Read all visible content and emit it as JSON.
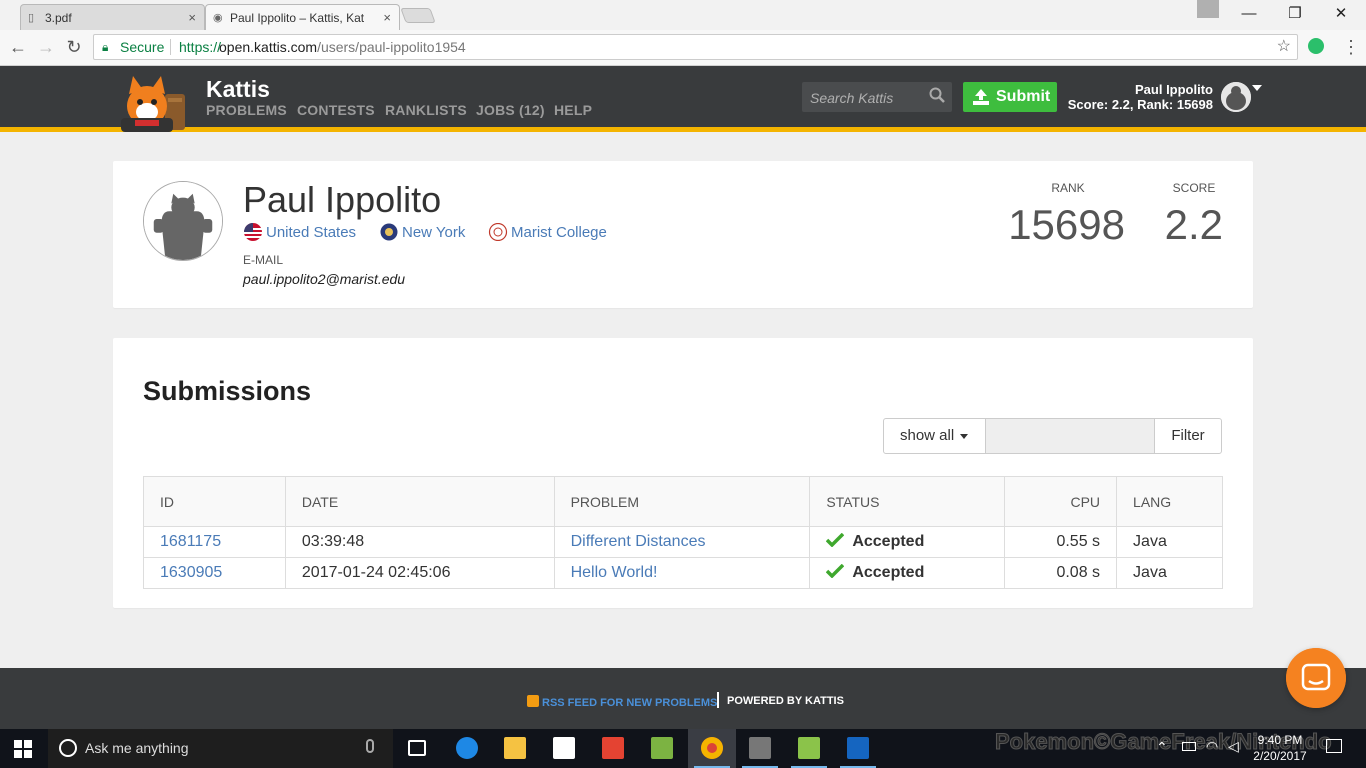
{
  "browser": {
    "tabs": [
      {
        "title": "3.pdf",
        "active": false
      },
      {
        "title": "Paul Ippolito – Kattis, Kat",
        "active": true
      }
    ],
    "close_glyph": "×",
    "secure_label": "Secure",
    "url_scheme": "https://",
    "url_host": "open.kattis.com",
    "url_path": "/users/paul-ippolito1954"
  },
  "kattis": {
    "brand": "Kattis",
    "nav": [
      "PROBLEMS",
      "CONTESTS",
      "RANKLISTS",
      "JOBS (12)",
      "HELP"
    ],
    "search_placeholder": "Search Kattis",
    "submit_label": "Submit",
    "user_name": "Paul Ippolito",
    "user_stats": "Score: 2.2, Rank: 15698",
    "brand_color": "#f4b400",
    "submit_color": "#3ebd3e"
  },
  "profile": {
    "name": "Paul Ippolito",
    "country": "United States",
    "region": "New York",
    "school": "Marist College",
    "email_label": "E-MAIL",
    "email": "paul.ippolito2@marist.edu",
    "rank_label": "RANK",
    "rank": "15698",
    "score_label": "SCORE",
    "score": "2.2"
  },
  "submissions": {
    "title": "Submissions",
    "filter_select": "show all",
    "filter_button": "Filter",
    "columns": [
      "ID",
      "DATE",
      "PROBLEM",
      "STATUS",
      "CPU",
      "LANG"
    ],
    "rows": [
      {
        "id": "1681175",
        "date": "03:39:48",
        "problem": "Different Distances",
        "status": "Accepted",
        "cpu": "0.55 s",
        "lang": "Java"
      },
      {
        "id": "1630905",
        "date": "2017-01-24 02:45:06",
        "problem": "Hello World!",
        "status": "Accepted",
        "cpu": "0.08 s",
        "lang": "Java"
      }
    ],
    "accepted_color": "#3fa82e",
    "link_color": "#4a7bb7"
  },
  "footer": {
    "rss": "RSS FEED FOR NEW PROBLEMS",
    "powered": "POWERED BY KATTIS"
  },
  "taskbar": {
    "search_placeholder": "Ask me anything",
    "watermark": "Pokemon©GameFreak/Nintendo",
    "time": "9:40 PM",
    "date": "2/20/2017",
    "apps": [
      "task-view-icon",
      "edge-icon",
      "file-explorer-icon",
      "store-icon",
      "todoist-icon",
      "wunderlist-icon",
      "chrome-icon",
      "game-icon",
      "notepad-icon",
      "powershell-icon"
    ]
  }
}
